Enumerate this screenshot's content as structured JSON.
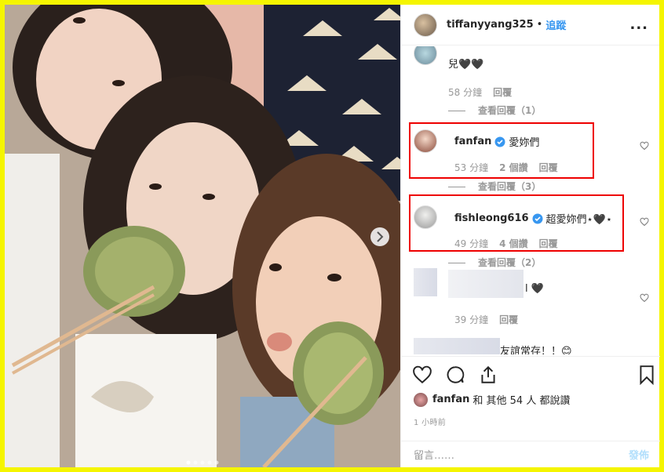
{
  "header": {
    "username": "tiffanyyang325",
    "dot": "•",
    "follow": "追蹤",
    "more": "..."
  },
  "comments": {
    "c0": {
      "text": "兒🖤🖤",
      "time": "58 分鐘",
      "reply": "回覆",
      "view_replies": "查看回覆（1）"
    },
    "c1": {
      "user": "fanfan",
      "text": "愛妳們",
      "time": "53 分鐘",
      "likes": "2 個讚",
      "reply": "回覆",
      "view_replies": "查看回覆（3）"
    },
    "c2": {
      "user": "fishleong616",
      "text": "超愛妳們⋆🖤⋆",
      "time": "49 分鐘",
      "likes": "4 個讚",
      "reply": "回覆",
      "view_replies": "查看回覆（2）"
    },
    "c3": {
      "text": "l 🖤",
      "time": "39 分鐘",
      "reply": "回覆"
    },
    "c4": {
      "text": "友誼常存！！😊"
    }
  },
  "likes": {
    "user": "fanfan",
    "text": "和 其他 54 人 都說讚"
  },
  "time": "1 小時前",
  "add_comment": {
    "placeholder": "留言……",
    "post": "發佈"
  },
  "colors": {
    "link": "#3897f0",
    "highlight": "#e00000",
    "frame": "#f5f500"
  }
}
